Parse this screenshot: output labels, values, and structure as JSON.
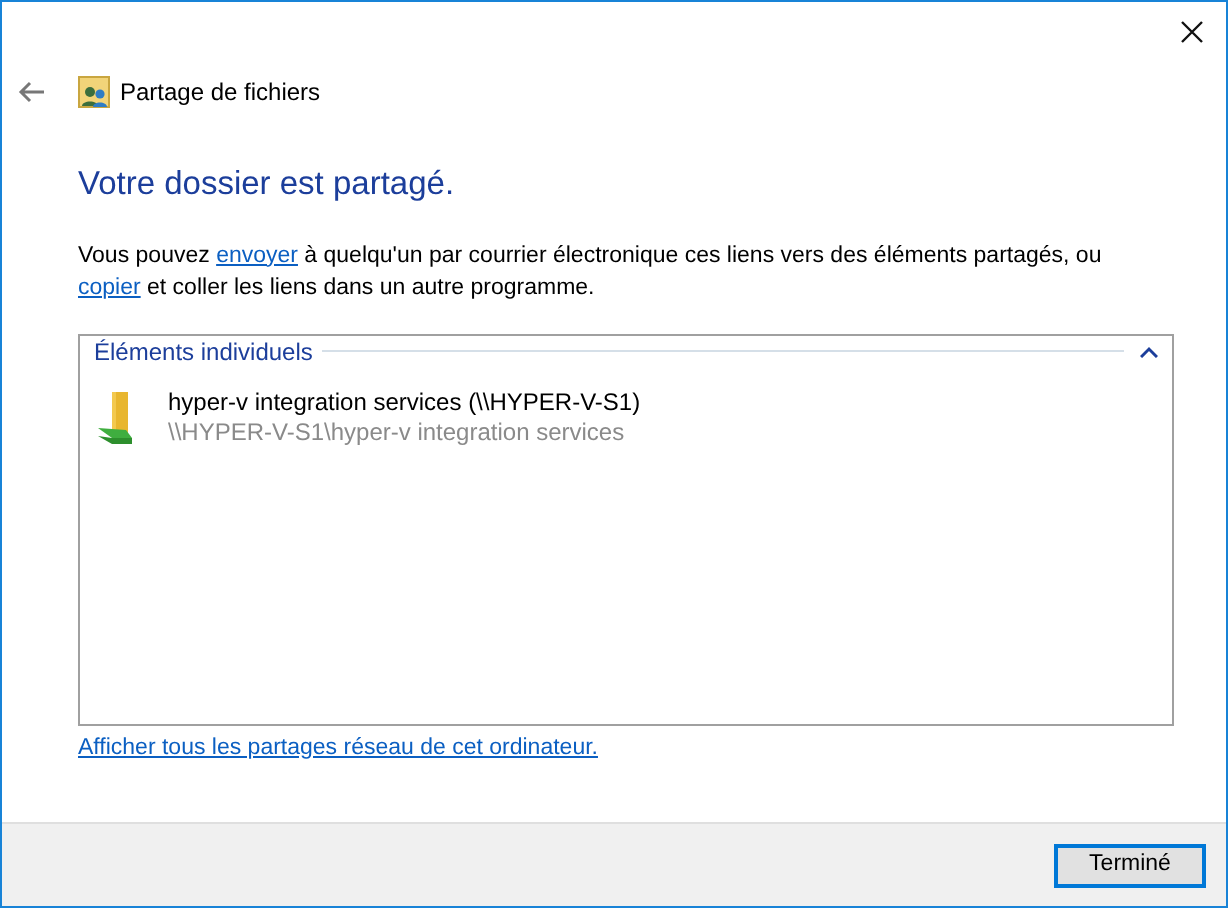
{
  "window": {
    "title": "Partage de fichiers"
  },
  "heading": "Votre dossier est partagé.",
  "description": [
    {
      "kind": "text",
      "text": "Vous pouvez "
    },
    {
      "kind": "link",
      "text": "envoyer"
    },
    {
      "kind": "text",
      "text": " à quelqu'un par courrier électronique ces liens vers des éléments partagés, ou "
    },
    {
      "kind": "link",
      "text": "copier"
    },
    {
      "kind": "text",
      "text": " et coller les liens dans un autre programme."
    }
  ],
  "group": {
    "title": "Éléments individuels",
    "expanded": true,
    "items": [
      {
        "name": "hyper-v integration services (\\\\HYPER-V-S1)",
        "path": "\\\\HYPER-V-S1\\hyper-v integration services"
      }
    ]
  },
  "network_link": "Afficher tous les partages réseau de cet ordinateur.",
  "buttons": [
    "Terminé"
  ]
}
